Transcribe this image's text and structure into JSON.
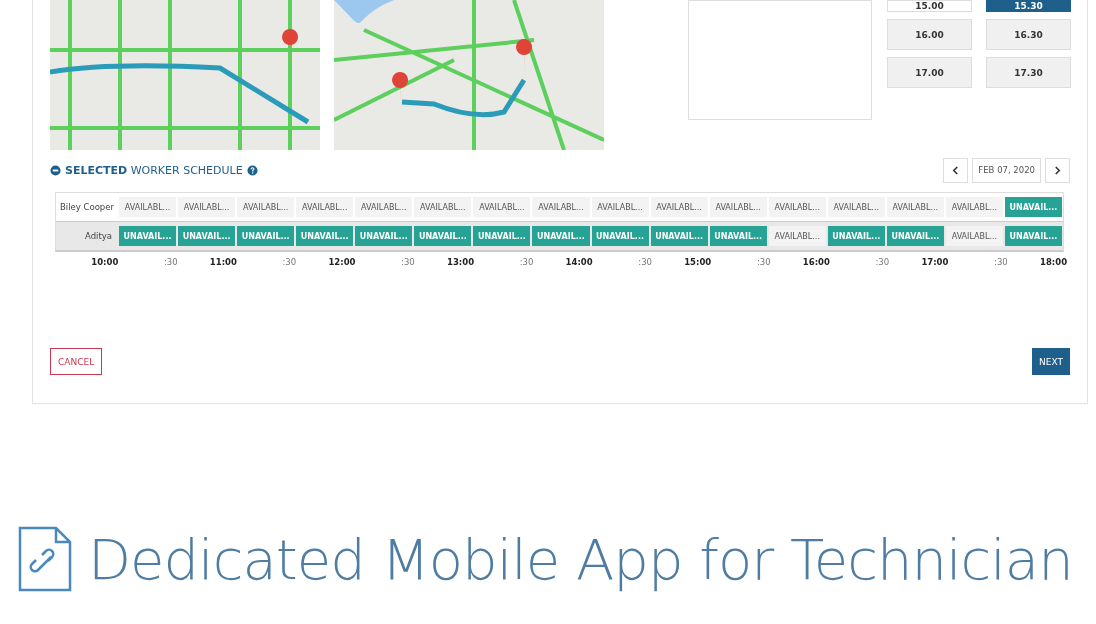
{
  "time_slots": [
    {
      "label": "15.00",
      "selected": false
    },
    {
      "label": "15.30",
      "selected": true
    },
    {
      "label": "16.00",
      "selected": false
    },
    {
      "label": "16.30",
      "selected": false
    },
    {
      "label": "17.00",
      "selected": false
    },
    {
      "label": "17.30",
      "selected": false
    }
  ],
  "schedule": {
    "title": "**SELECTED** WORKER SCHEDULE",
    "date": "FEB 07, 2020",
    "rows": [
      {
        "name": "Biley Cooper",
        "cells": [
          {
            "kind": "available",
            "text": "AVAILABL..."
          },
          {
            "kind": "available",
            "text": "AVAILABL..."
          },
          {
            "kind": "available",
            "text": "AVAILABL..."
          },
          {
            "kind": "available",
            "text": "AVAILABL..."
          },
          {
            "kind": "available",
            "text": "AVAILABL..."
          },
          {
            "kind": "available",
            "text": "AVAILABL..."
          },
          {
            "kind": "available",
            "text": "AVAILABL..."
          },
          {
            "kind": "available",
            "text": "AVAILABL..."
          },
          {
            "kind": "available",
            "text": "AVAILABL..."
          },
          {
            "kind": "available",
            "text": "AVAILABL..."
          },
          {
            "kind": "available",
            "text": "AVAILABL..."
          },
          {
            "kind": "available",
            "text": "AVAILABL..."
          },
          {
            "kind": "available",
            "text": "AVAILABL..."
          },
          {
            "kind": "available",
            "text": "AVAILABL..."
          },
          {
            "kind": "available",
            "text": "AVAILABL..."
          },
          {
            "kind": "unavailable",
            "text": "UNAVAIL..."
          }
        ]
      },
      {
        "name": "Aditya",
        "cells": [
          {
            "kind": "unavailable",
            "text": "UNAVAIL..."
          },
          {
            "kind": "unavailable",
            "text": "UNAVAIL..."
          },
          {
            "kind": "unavailable",
            "text": "UNAVAIL..."
          },
          {
            "kind": "unavailable",
            "text": "UNAVAIL..."
          },
          {
            "kind": "unavailable",
            "text": "UNAVAIL..."
          },
          {
            "kind": "unavailable",
            "text": "UNAVAIL..."
          },
          {
            "kind": "unavailable",
            "text": "UNAVAIL..."
          },
          {
            "kind": "unavailable",
            "text": "UNAVAIL..."
          },
          {
            "kind": "unavailable",
            "text": "UNAVAIL..."
          },
          {
            "kind": "unavailable",
            "text": "UNAVAIL..."
          },
          {
            "kind": "unavailable",
            "text": "UNAVAIL..."
          },
          {
            "kind": "available",
            "text": "AVAILABL..."
          },
          {
            "kind": "unavailable",
            "text": "UNAVAIL..."
          },
          {
            "kind": "unavailable",
            "text": "UNAVAIL..."
          },
          {
            "kind": "available",
            "text": "AVAILABL..."
          },
          {
            "kind": "unavailable",
            "text": "UNAVAIL..."
          }
        ]
      }
    ],
    "ticks": [
      {
        "label": "10:00",
        "kind": "hour"
      },
      {
        "label": ":30",
        "kind": "half"
      },
      {
        "label": "11:00",
        "kind": "hour"
      },
      {
        "label": ":30",
        "kind": "half"
      },
      {
        "label": "12:00",
        "kind": "hour"
      },
      {
        "label": ":30",
        "kind": "half"
      },
      {
        "label": "13:00",
        "kind": "hour"
      },
      {
        "label": ":30",
        "kind": "half"
      },
      {
        "label": "14:00",
        "kind": "hour"
      },
      {
        "label": ":30",
        "kind": "half"
      },
      {
        "label": "15:00",
        "kind": "hour"
      },
      {
        "label": ":30",
        "kind": "half"
      },
      {
        "label": "16:00",
        "kind": "hour"
      },
      {
        "label": ":30",
        "kind": "half"
      },
      {
        "label": "17:00",
        "kind": "hour"
      },
      {
        "label": ":30",
        "kind": "half"
      },
      {
        "label": "18:00",
        "kind": "hour"
      }
    ]
  },
  "buttons": {
    "cancel": "CANCEL",
    "next": "NEXT"
  },
  "heading": "Dedicated Mobile App for Technician"
}
